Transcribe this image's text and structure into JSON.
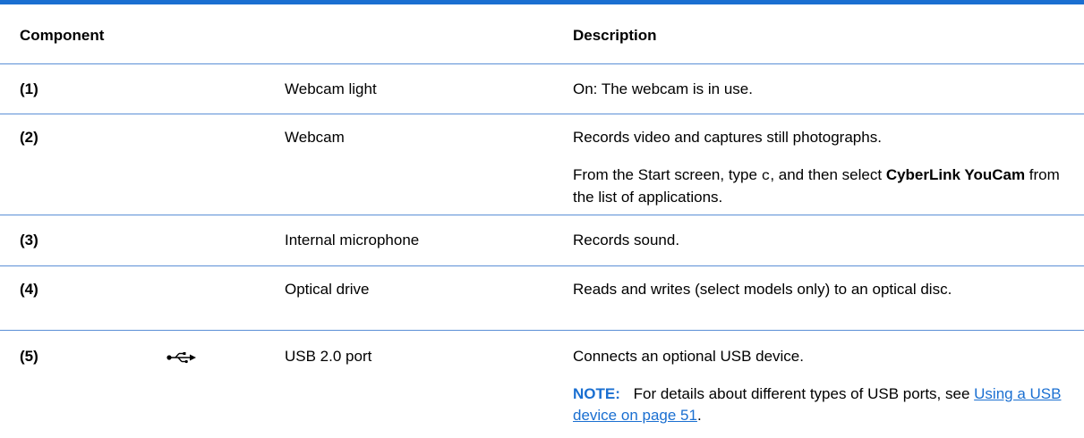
{
  "table": {
    "header": {
      "component": "Component",
      "description": "Description"
    },
    "rows": [
      {
        "number": "(1)",
        "icon": "",
        "name": "Webcam light",
        "desc1": "On: The webcam is in use."
      },
      {
        "number": "(2)",
        "icon": "",
        "name": "Webcam",
        "desc1": "Records video and captures still photographs.",
        "desc2_pre": "From the Start screen, type",
        "desc2_code": "c",
        "desc2_mid": ", and then select",
        "desc2_bold": "CyberLink YouCam",
        "desc2_post": "from the list of applications."
      },
      {
        "number": "(3)",
        "icon": "",
        "name": "Internal microphone",
        "desc1": "Records sound."
      },
      {
        "number": "(4)",
        "icon": "",
        "name": "Optical drive",
        "desc1": "Reads and writes (select models only) to an optical disc."
      },
      {
        "number": "(5)",
        "icon": "usb-icon",
        "name": "USB 2.0 port",
        "desc1": "Connects an optional USB device.",
        "note_label": "NOTE:",
        "note_pre": "For details about different types of USB ports, see",
        "note_link": "Using a USB device on page 51",
        "note_post": "."
      }
    ]
  },
  "colors": {
    "accent": "#1a6fd1",
    "rule": "#5b8fd6"
  }
}
